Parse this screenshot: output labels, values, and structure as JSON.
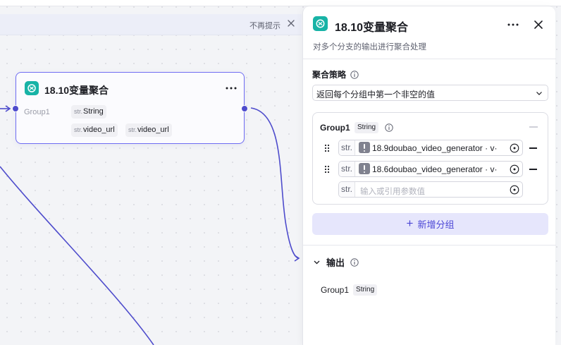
{
  "notice": {
    "dismiss_label": "不再提示"
  },
  "node": {
    "title": "18.10变量聚合",
    "group_label": "Group1",
    "type_prefix": "str.",
    "output_type": "String",
    "inputs": [
      "video_url",
      "video_url"
    ]
  },
  "panel": {
    "title": "18.10变量聚合",
    "description": "对多个分支的输出进行聚合处理",
    "strategy": {
      "label": "聚合策略",
      "value": "返回每个分组中第一个非空的值"
    },
    "group": {
      "name": "Group1",
      "type": "String",
      "refs": [
        {
          "type_prefix": "str.",
          "value": "18.9doubao_video_generator · v·"
        },
        {
          "type_prefix": "str.",
          "value": "18.6doubao_video_generator · v·"
        }
      ],
      "empty_ref": {
        "type_prefix": "str.",
        "placeholder": "输入或引用参数值"
      }
    },
    "add_group_label": "新增分组",
    "output": {
      "title": "输出",
      "items": [
        {
          "name": "Group1",
          "type": "String"
        }
      ]
    }
  },
  "colors": {
    "accent": "#4e4ccc",
    "node_border": "#6e6cf2",
    "logo": "#18b3a6",
    "add_group_bg": "#e6e6fc"
  },
  "icons": [
    "close-icon",
    "more-icon",
    "aggregate-logo-icon",
    "info-icon",
    "chevron-down-icon",
    "drag-handle-icon",
    "variable-picker-icon",
    "warning-icon",
    "plus-icon"
  ]
}
